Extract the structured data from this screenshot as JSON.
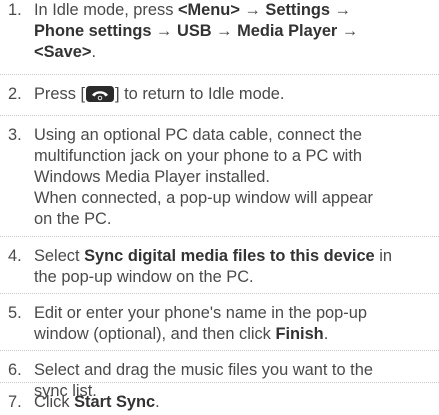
{
  "steps": [
    {
      "number": "1.",
      "line1": {
        "a": "In Idle mode, press ",
        "b": "<Menu>",
        "c": " → ",
        "d": "Settings",
        "e": " →"
      },
      "line2": {
        "a": "Phone settings",
        "b": " → ",
        "c": "USB",
        "d": " → ",
        "e": "Media Player",
        "f": " →"
      },
      "line3": {
        "a": "<Save>",
        "b": "."
      }
    },
    {
      "number": "2.",
      "before": "Press [",
      "icon": "end-call-key-icon",
      "after": "] to return to Idle mode."
    },
    {
      "number": "3.",
      "lines": [
        "Using an optional PC data cable, connect the",
        "multifunction jack on your phone to a PC with",
        "Windows Media Player installed.",
        "When connected, a pop-up window will appear",
        "on the PC."
      ]
    },
    {
      "number": "4.",
      "line1": {
        "a": "Select ",
        "b": "Sync digital media files to this device",
        "c": " in"
      },
      "line2": "the pop-up window on the PC."
    },
    {
      "number": "5.",
      "line1": "Edit or enter your phone's name in the pop-up",
      "line2": {
        "a": "window (optional), and then click ",
        "b": "Finish",
        "c": "."
      }
    },
    {
      "number": "6.",
      "lines": [
        "Select and drag the music files you want to the",
        "sync list."
      ]
    },
    {
      "number": "7.",
      "line1": {
        "a": "Click ",
        "b": "Start Sync",
        "c": "."
      }
    }
  ]
}
